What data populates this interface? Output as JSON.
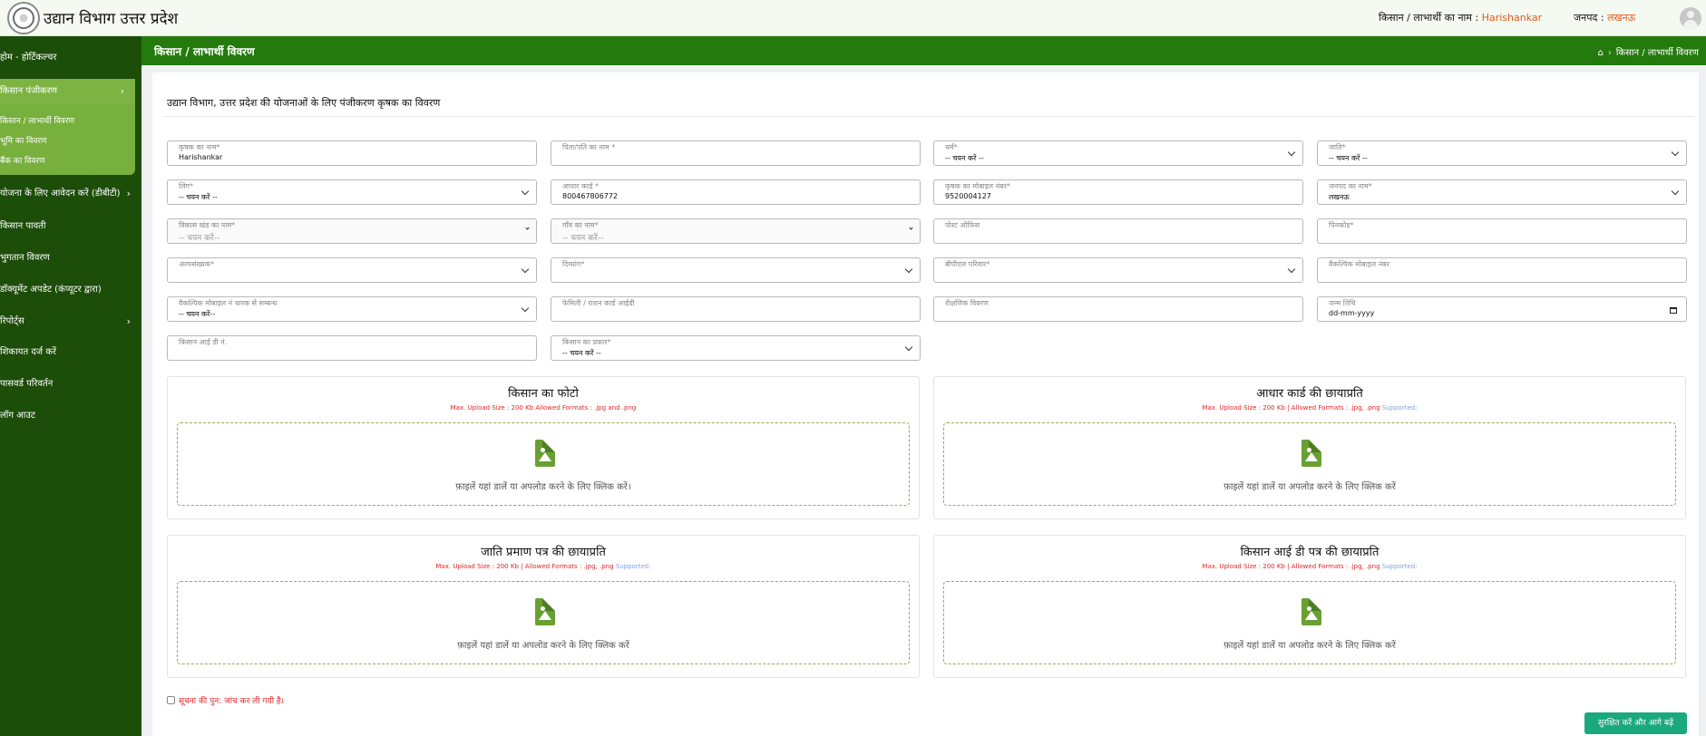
{
  "header": {
    "app_title": "उद्यान विभाग उत्तर प्रदेश",
    "user_label": "किसान / लाभार्थी का नाम :",
    "user_name": "Harishankar",
    "district_label": "जनपद :",
    "district_name": "लखनऊ"
  },
  "sidebar": {
    "items": [
      {
        "label": "होम - होर्टिकल्चर"
      },
      {
        "label": "किसान पंजीकरण",
        "chevron": "›"
      },
      {
        "label": "योजना के लिए आवेदन करें (डीबीटी)",
        "chevron": "›"
      },
      {
        "label": "किसान पावती"
      },
      {
        "label": "भुगतान विवरण"
      },
      {
        "label": "डॉक्यूमेंट अपडेट (कंप्यूटर द्वारा)"
      },
      {
        "label": "रिपोर्ट्स",
        "chevron": "›"
      },
      {
        "label": "शिकायत दर्ज करें"
      },
      {
        "label": "पासवर्ड परिवर्तन"
      },
      {
        "label": "लॉग आउट"
      }
    ],
    "submenu": [
      {
        "label": "किसान / लाभार्थी विवरण"
      },
      {
        "label": "भूमि का विवरण"
      },
      {
        "label": "बैंक का विवरण"
      }
    ]
  },
  "page": {
    "title": "किसान / लाभार्थी विवरण",
    "breadcrumb_current": "किसान / लाभार्थी विवरण",
    "form_heading": "उद्यान विभाग, उत्तर प्रदेश की योजनाओं के लिए पंजीकरण कृषक का विवरण"
  },
  "form": {
    "fields": [
      {
        "label": "कृषक का नाम*",
        "value": "Harishankar",
        "type": "text"
      },
      {
        "label": "पिता/पति का नाम *",
        "value": "",
        "type": "text"
      },
      {
        "label": "धर्म*",
        "value": "-- चयन करें --",
        "type": "select"
      },
      {
        "label": "जाति*",
        "value": "-- चयन करें --",
        "type": "select"
      },
      {
        "label": "लिंग*",
        "value": "-- चयन करें --",
        "type": "select"
      },
      {
        "label": "आधार कार्ड *",
        "value": "800467806772",
        "type": "text"
      },
      {
        "label": "कृषक का मोबाइल नंबर*",
        "value": "9520004127",
        "type": "text"
      },
      {
        "label": "जनपद का नाम*",
        "value": "लखनऊ",
        "type": "select"
      },
      {
        "label": "विकास खंड का नाम*",
        "value": "-- चयन करें--",
        "type": "select-disabled"
      },
      {
        "label": "गाँव का नाम*",
        "value": "-- चयन करें--",
        "type": "select-disabled"
      },
      {
        "label": "पोस्ट ऑफिस",
        "value": "",
        "type": "text"
      },
      {
        "label": "पिनकोड*",
        "value": "",
        "type": "text"
      },
      {
        "label": "अल्पसंख्यक*",
        "value": "",
        "type": "select"
      },
      {
        "label": "दिव्यांग*",
        "value": "",
        "type": "select"
      },
      {
        "label": "बीपीएल परिवार*",
        "value": "",
        "type": "select"
      },
      {
        "label": "वैकल्पिक मोबाइल नंबर",
        "value": "",
        "type": "text"
      },
      {
        "label": "वैकल्पिक मोबाइल नं धारक से सम्बन्ध",
        "value": "-- चयन करें--",
        "type": "select"
      },
      {
        "label": "फेमिली / राशन कार्ड आईडी",
        "value": "",
        "type": "text"
      },
      {
        "label": "शैक्षणिक विवरण",
        "value": "",
        "type": "text"
      },
      {
        "label": "जन्म तिथि",
        "value": "dd-mm-yyyy",
        "type": "date"
      },
      {
        "label": "किसान आई डी नं.",
        "value": "",
        "type": "text"
      },
      {
        "label": "किसान का प्रकार*",
        "value": "-- चयन करें --",
        "type": "select"
      }
    ],
    "uploads": [
      {
        "title": "किसान का फोटो",
        "note": "Max. Upload Size : 200 Kb Allowed Formats : .jpg and .png",
        "supported": "",
        "drop_text": "फ़ाइलें यहां डालें या अपलोड करने के लिए क्लिक करें।"
      },
      {
        "title": "आधार कार्ड की छायाप्रति",
        "note": "Max. Upload Size : 200 Kb | Allowed Formats : .jpg, .png",
        "supported": "Supported:",
        "drop_text": "फ़ाइलें यहां डालें या अपलोड करने के लिए क्लिक करें"
      },
      {
        "title": "जाति प्रमाण पत्र की छायाप्रति",
        "note": "Max. Upload Size : 200 Kb | Allowed Formats : .jpg, .png",
        "supported": "Supported:",
        "drop_text": "फ़ाइलें यहां डालें या अपलोड करने के लिए क्लिक करें"
      },
      {
        "title": "किसान आई डी पत्र की छायाप्रति",
        "note": "Max. Upload Size : 200 Kb | Allowed Formats : .jpg, .png",
        "supported": "Supported:",
        "drop_text": "फ़ाइलें यहां डालें या अपलोड करने के लिए क्लिक करें"
      }
    ],
    "confirm_label": "सूचना की पुन: जांच कर ली गयी है।",
    "submit_label": "सुरक्षित करें और आगे बढ़ें"
  },
  "icons": {
    "home": "home-icon",
    "file_image": "file-image-icon",
    "chevron": "chevron-right-icon"
  },
  "colors": {
    "sidebar_bg": "#1c4d09",
    "page_bar_bg": "#247a0d",
    "active_menu": "#7cb342",
    "accent_orange": "#e25a1c",
    "submit_button": "#1aa97d",
    "upload_icon": "#6aa033"
  }
}
